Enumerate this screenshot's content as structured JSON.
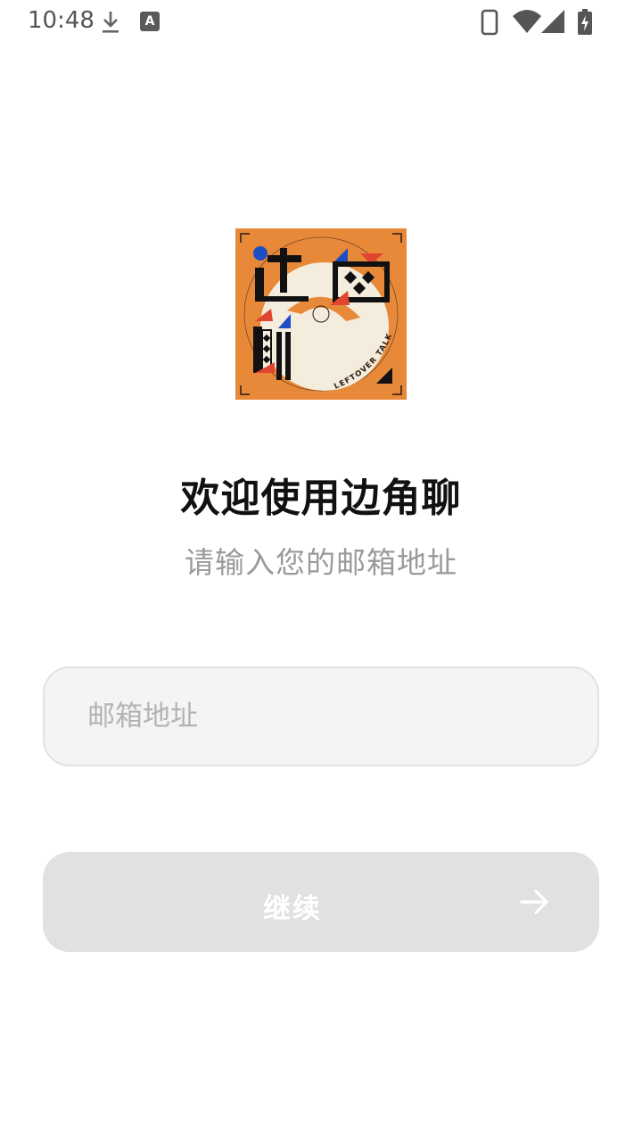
{
  "status_bar": {
    "time": "10:48",
    "icons": [
      "download-icon",
      "a-badge-icon",
      "phone-icon",
      "wifi-icon",
      "signal-icon",
      "battery-charging-icon"
    ],
    "a_badge": "A"
  },
  "logo": {
    "name": "边角聊 app logo",
    "text": "LEFTOVER TALK",
    "colors": {
      "orange": "#e8893a",
      "black": "#111111",
      "red": "#e0452f",
      "blue": "#1e4fc2",
      "cream": "#f4ecdc"
    }
  },
  "welcome": {
    "title": "欢迎使用边角聊",
    "subtitle": "请输入您的邮箱地址"
  },
  "email": {
    "placeholder": "邮箱地址",
    "value": ""
  },
  "continue_button": {
    "label": "继续",
    "icon": "arrow-right-icon",
    "state": "disabled",
    "background": "#e1e1e1"
  }
}
